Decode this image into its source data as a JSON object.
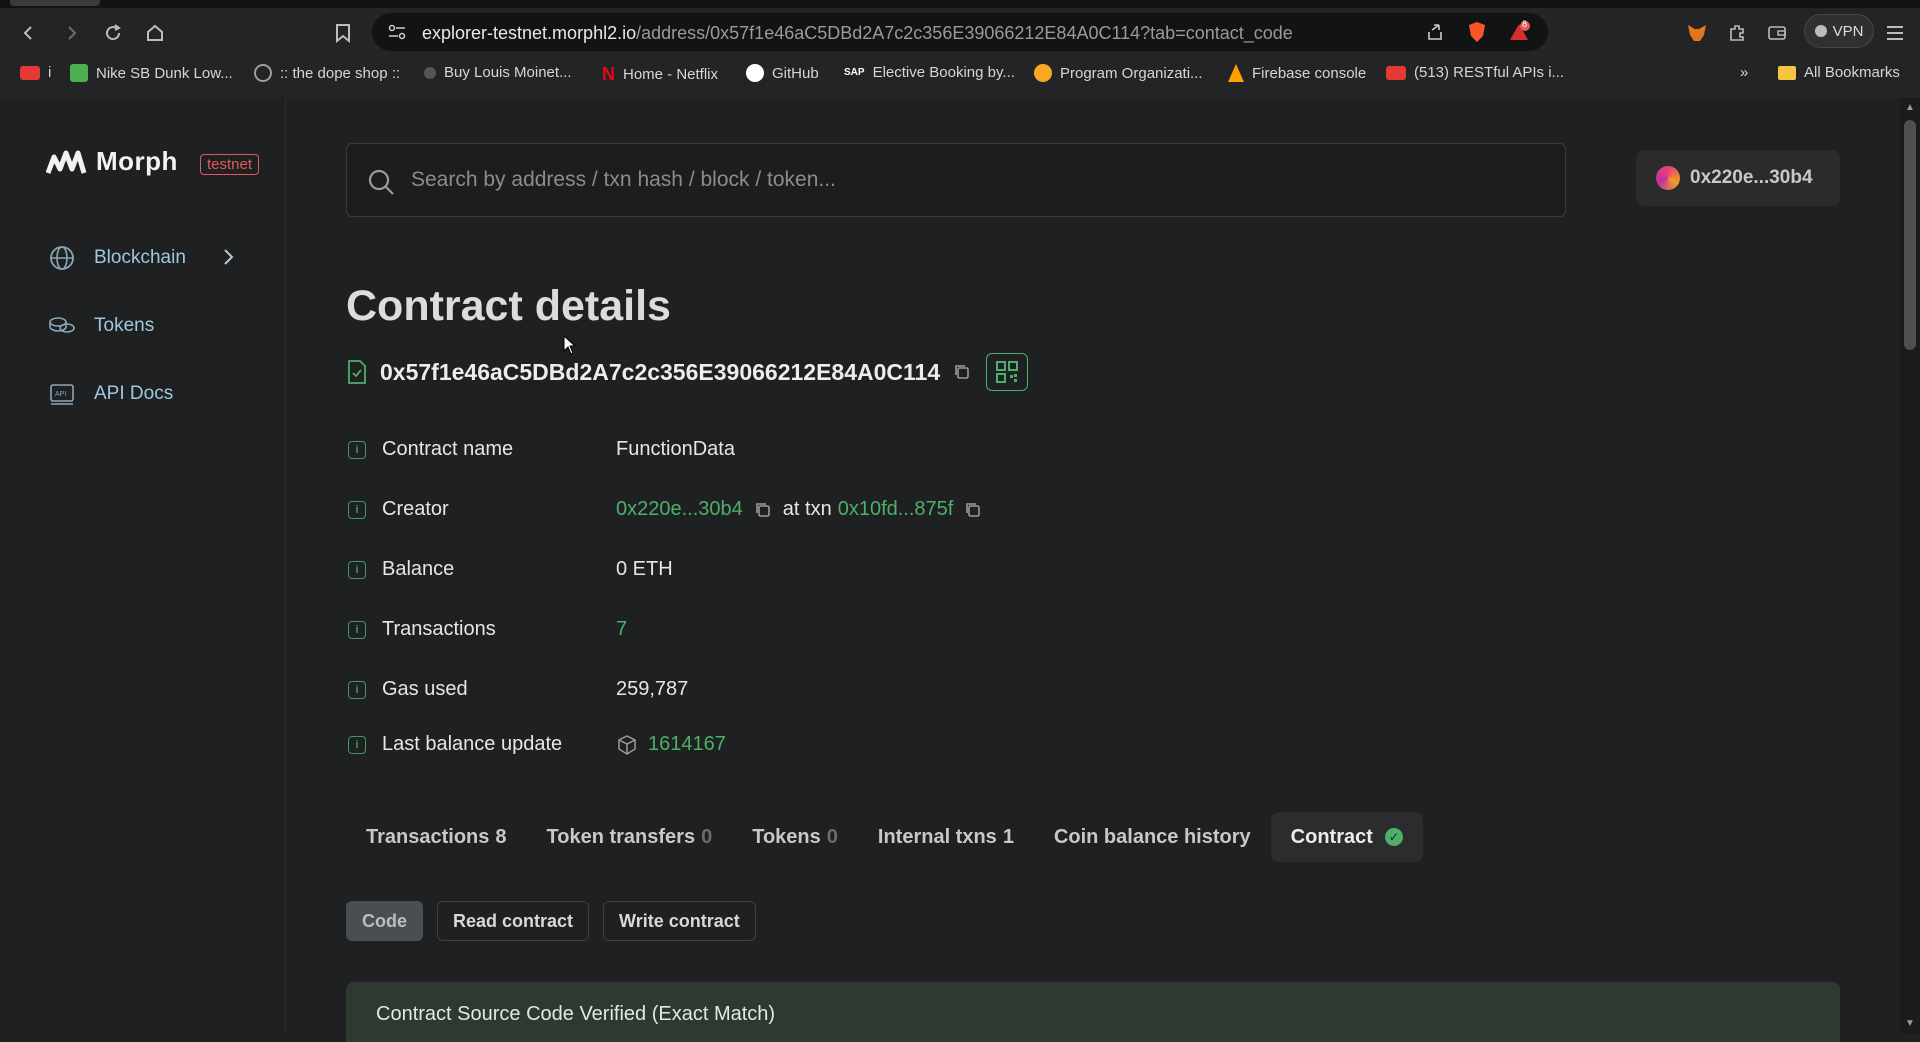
{
  "browser": {
    "url_host": "explorer-testnet.morphl2.io",
    "url_path": "/address/0x57f1e46aC5DBd2A7c2c356E39066212E84A0C114?tab=contact_code",
    "vpn_label": "VPN",
    "notification_count": "8",
    "bookmarks": [
      {
        "label": "i",
        "icon_color": "#e53935"
      },
      {
        "label": "Nike SB Dunk Low...",
        "icon_color": "#4caf50"
      },
      {
        "label": ":: the dope shop ::",
        "icon_color": "#9e9e9e"
      },
      {
        "label": "Buy Louis Moinet...",
        "icon_color": "#555555"
      },
      {
        "label": "Home - Netflix",
        "icon_color": "#e50914"
      },
      {
        "label": "GitHub",
        "icon_color": "#ffffff"
      },
      {
        "label": "Elective Booking by...",
        "icon_color": "#1565c0"
      },
      {
        "label": "Program Organizati...",
        "icon_color": "#f9a825"
      },
      {
        "label": "Firebase console",
        "icon_color": "#ffa000"
      },
      {
        "label": "(513) RESTful APIs i...",
        "icon_color": "#e53935"
      }
    ],
    "all_bookmarks_label": "All Bookmarks"
  },
  "sidebar": {
    "logo_text": "Morph",
    "badge": "testnet",
    "items": [
      {
        "label": "Blockchain",
        "icon": "globe-icon"
      },
      {
        "label": "Tokens",
        "icon": "coins-icon"
      },
      {
        "label": "API Docs",
        "icon": "api-icon"
      }
    ]
  },
  "search": {
    "placeholder": "Search by address / txn hash / block / token..."
  },
  "account": {
    "label": "0x220e...30b4"
  },
  "page": {
    "title": "Contract details",
    "address": "0x57f1e46aC5DBd2A7c2c356E39066212E84A0C114"
  },
  "details": {
    "contract_name": {
      "label": "Contract name",
      "value": "FunctionData"
    },
    "creator": {
      "label": "Creator",
      "value": "0x220e...30b4",
      "at_txn": "at txn",
      "txn": "0x10fd...875f"
    },
    "balance": {
      "label": "Balance",
      "value": "0 ETH"
    },
    "transactions": {
      "label": "Transactions",
      "value": "7"
    },
    "gas_used": {
      "label": "Gas used",
      "value": "259,787"
    },
    "last_balance_update": {
      "label": "Last balance update",
      "value": "1614167"
    }
  },
  "tabs": [
    {
      "label": "Transactions",
      "count": "8"
    },
    {
      "label": "Token transfers",
      "count": "0"
    },
    {
      "label": "Tokens",
      "count": "0"
    },
    {
      "label": "Internal txns",
      "count": "1"
    },
    {
      "label": "Coin balance history",
      "count": ""
    },
    {
      "label": "Contract",
      "count": ""
    }
  ],
  "subtabs": {
    "code": "Code",
    "read": "Read contract",
    "write": "Write contract"
  },
  "verified_banner": "Contract Source Code Verified (Exact Match)",
  "colors": {
    "accent_green": "#4caf6a",
    "testnet_red": "#e05a5a",
    "banner_bg": "#2e3a31"
  }
}
